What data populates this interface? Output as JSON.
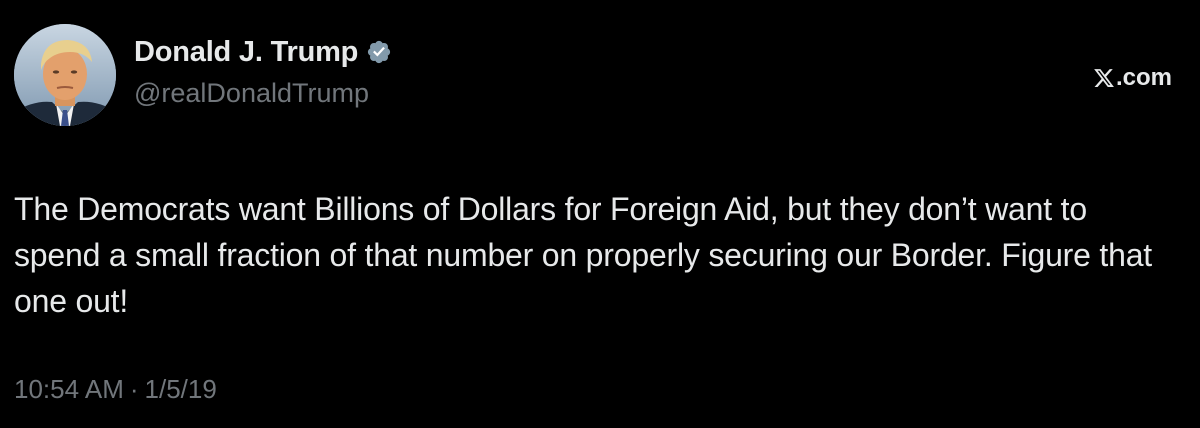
{
  "tweet": {
    "author": {
      "display_name": "Donald J. Trump",
      "handle": "@realDonaldTrump",
      "verified": true,
      "verified_color": "#829aab"
    },
    "source": {
      "label": ".com",
      "logo_icon": "x-logo-icon"
    },
    "text": "The Democrats want Billions of Dollars for Foreign Aid, but they don’t want to spend a small fraction of that number on properly securing our Border. Figure that one out!",
    "time": "10:54 AM",
    "separator": "·",
    "date": "1/5/19"
  },
  "colors": {
    "background": "#000000",
    "primary_text": "#e7e9ea",
    "secondary_text": "#71767b"
  }
}
